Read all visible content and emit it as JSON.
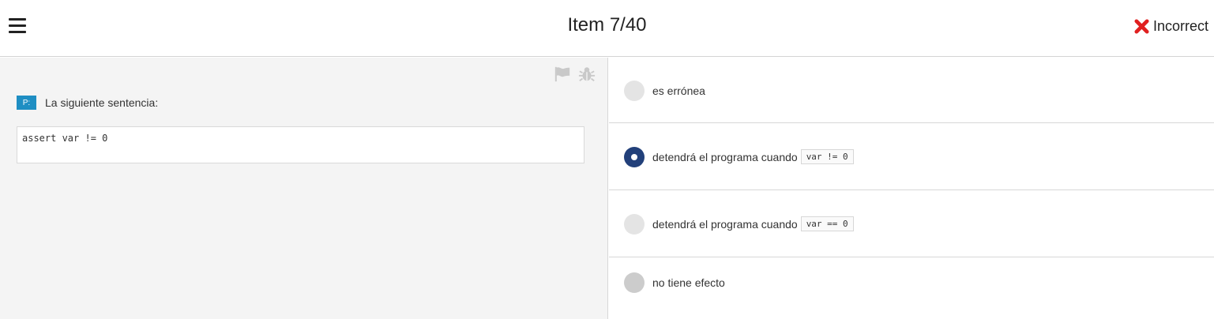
{
  "header": {
    "title": "Item 7/40",
    "status_label": "Incorrect",
    "status_color": "#e02020"
  },
  "question": {
    "badge": "P:",
    "text": "La siguiente sentencia:",
    "code": "assert var != 0",
    "icons": [
      "flag-icon",
      "bug-icon"
    ]
  },
  "options": [
    {
      "text": "es errónea",
      "code": ""
    },
    {
      "text": "detendrá el programa cuando",
      "code": "var != 0",
      "selected": true
    },
    {
      "text": "detendrá el programa cuando",
      "code": "var == 0"
    },
    {
      "text": "no tiene efecto",
      "code": ""
    }
  ],
  "colors": {
    "badge": "#1e8ec3",
    "selected_radio": "#22407a"
  }
}
